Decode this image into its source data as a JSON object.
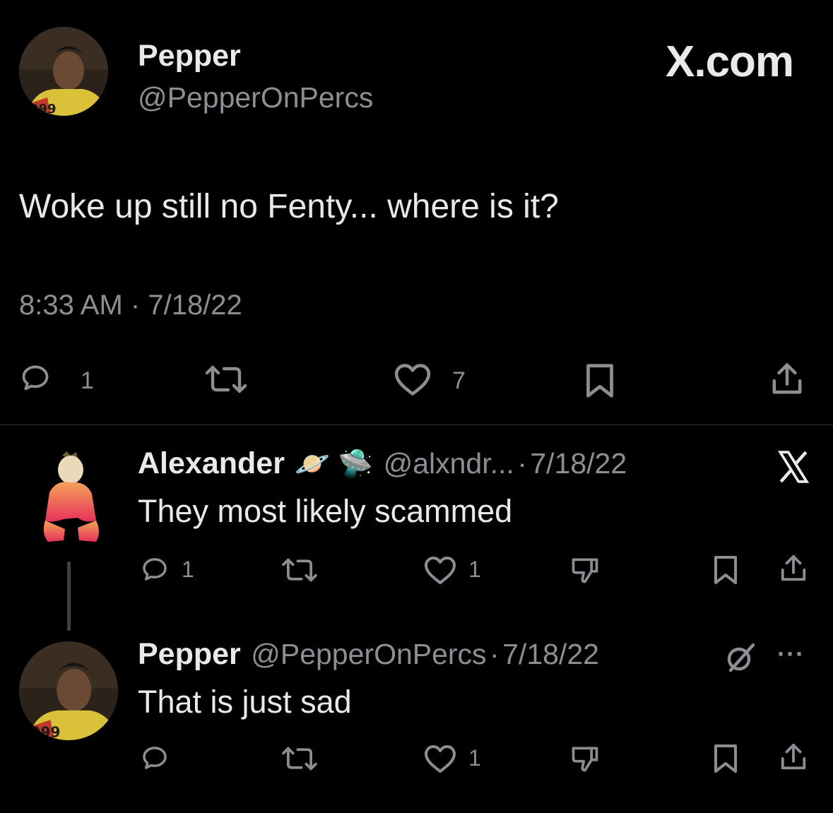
{
  "main_tweet": {
    "author_name": "Pepper",
    "author_handle": "@PepperOnPercs",
    "brand": "X.com",
    "text": "Woke up still no Fenty... where is it?",
    "time": "8:33 AM",
    "separator": "·",
    "date": "7/18/22",
    "reply_count": "1",
    "like_count": "7"
  },
  "replies": [
    {
      "author_name": "Alexander",
      "author_emoji": "🪐 🛸",
      "author_handle": "@alxndr...",
      "meta_sep": "·",
      "date": "7/18/22",
      "text": "They most likely scammed",
      "reply_count": "1",
      "like_count": "1"
    },
    {
      "author_name": "Pepper",
      "author_handle": "@PepperOnPercs",
      "meta_sep": "·",
      "date": "7/18/22",
      "text": "That is just sad",
      "like_count": "1",
      "more_label": "···"
    }
  ],
  "colors": {
    "background": "#000000",
    "text": "#e7e9ea",
    "secondary": "#8b8f94",
    "divider": "#2f3336"
  }
}
